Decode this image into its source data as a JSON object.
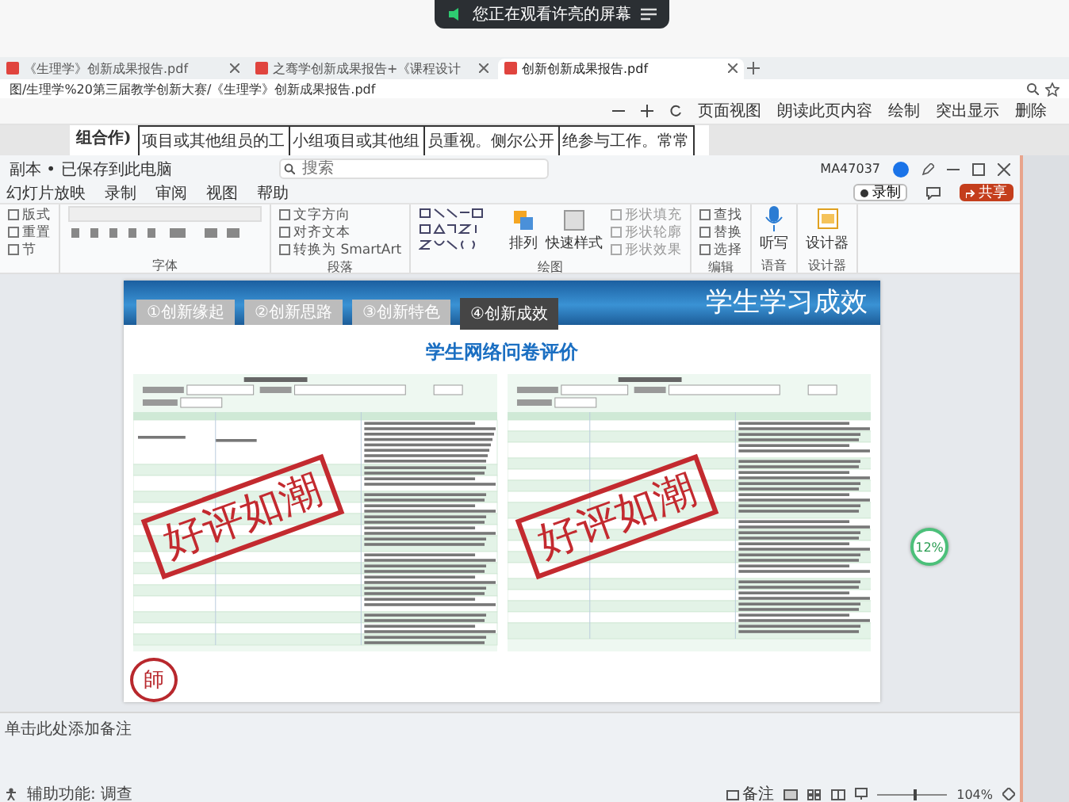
{
  "screen_share_banner": {
    "text": "您正在观看许亮的屏幕"
  },
  "browser": {
    "tabs": [
      {
        "label": "《生理学》创新成果报告.pdf",
        "selected": false
      },
      {
        "label": "之骞学创新成果报告+《课程设计",
        "selected": false
      },
      {
        "label": "创新创新成果报告.pdf",
        "selected": true
      }
    ],
    "address": "图/生理学%20第三届教学创新大赛/《生理学》创新成果报告.pdf",
    "toolbar": [
      "页面视图",
      "朗读此页内容",
      "绘制",
      "突出显示",
      "删除"
    ],
    "pdf_text": {
      "label": "组合作)",
      "cells": [
        "项目或其他组员的工",
        "小组项目或其他组",
        "员重视。侧尔公开",
        "绝参与工作。常常"
      ]
    }
  },
  "ppt": {
    "title": "副本 • 已保存到此电脑",
    "search": {
      "placeholder": "搜索"
    },
    "user": "MA47037",
    "menu": [
      "幻灯片放映",
      "录制",
      "审阅",
      "视图",
      "帮助"
    ],
    "actions": [
      {
        "label": "录制",
        "kind": "record"
      },
      {
        "label": "共享",
        "kind": "share"
      }
    ],
    "ribbon_groups": [
      {
        "items": [
          "版式",
          "重置",
          "节"
        ],
        "kind": "list"
      },
      {
        "label": "字体",
        "kind": "font"
      },
      {
        "label": "段落",
        "items": [
          "文字方向",
          "对齐文本",
          "转换为 SmartArt"
        ],
        "kind": "list"
      },
      {
        "label": "绘图",
        "items": [
          "排列",
          "快速样式",
          "形状填充",
          "形状轮廓",
          "形状效果"
        ],
        "kind": "draw"
      },
      {
        "label": "编辑",
        "items": [
          "查找",
          "替换",
          "选择"
        ],
        "kind": "list"
      },
      {
        "label": "语音",
        "items": [
          "听写"
        ],
        "kind": "big"
      },
      {
        "label": "设计器",
        "items": [
          "设计器"
        ],
        "kind": "big"
      }
    ],
    "slide": {
      "tabs": [
        {
          "label": "①创新缘起",
          "selected": false
        },
        {
          "label": "②创新思路",
          "selected": false
        },
        {
          "label": "③创新特色",
          "selected": false
        },
        {
          "label": "④创新成效",
          "selected": true
        }
      ],
      "heading": "学生学习成效",
      "title": "学生网络问卷评价",
      "stamps": [
        "好评如潮",
        "好评如潮"
      ],
      "seal": "師"
    },
    "notes_placeholder": "单击此处添加备注",
    "status": {
      "accessibility": "辅助功能: 调查",
      "notes": "备注",
      "zoom": "104%",
      "zoom_slider": {
        "level": 0.55
      }
    }
  },
  "net_widget": {
    "percent": "12%"
  }
}
